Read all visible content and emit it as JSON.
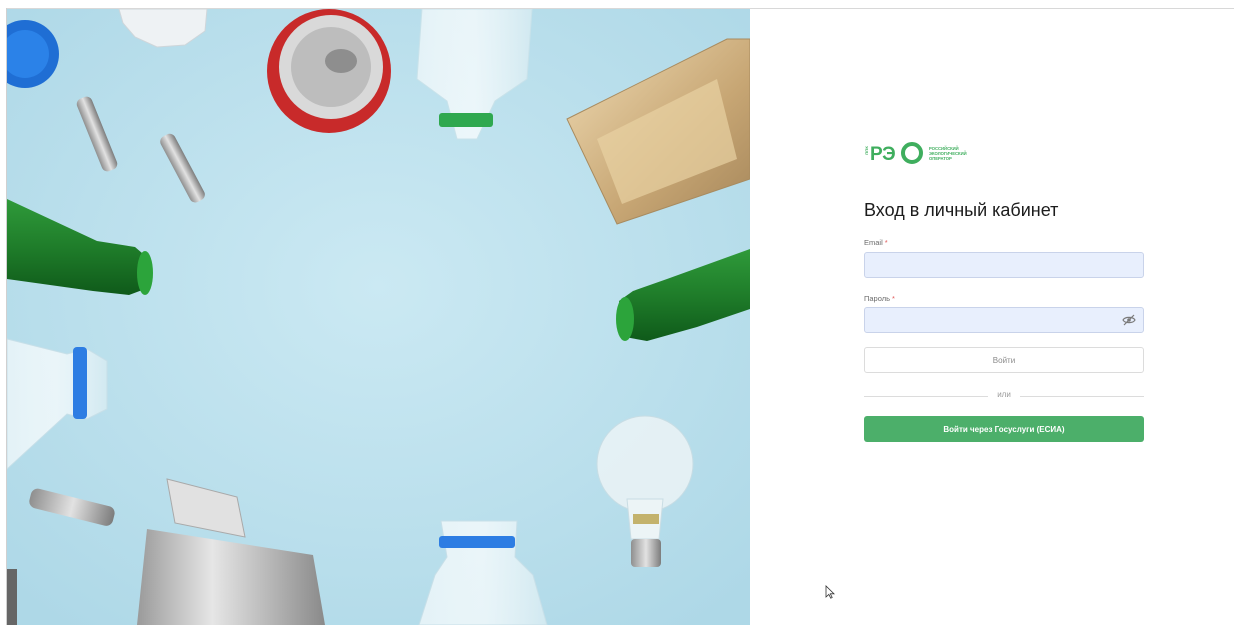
{
  "logo": {
    "side_text": "ППК",
    "letters": "РЭ",
    "lines": [
      "РОССИЙСКИЙ",
      "ЭКОЛОГИЧЕСКИЙ",
      "ОПЕРАТОР"
    ]
  },
  "form": {
    "title": "Вход в личный кабинет",
    "email_label": "Email",
    "email_value": "",
    "password_label": "Пароль",
    "password_value": "",
    "required_mark": "*",
    "login_button": "Войти",
    "or_text": "или",
    "gosuslugi_button": "Войти через Госуслуги (ЕСИА)"
  },
  "colors": {
    "brand_green": "#3fae5e",
    "button_green": "#4caf6a",
    "input_bg": "#e8effd",
    "photo_bg": "#bfe2ee"
  },
  "icons": {
    "password_toggle": "eye-off-icon",
    "cursor": "mouse-pointer-icon"
  }
}
